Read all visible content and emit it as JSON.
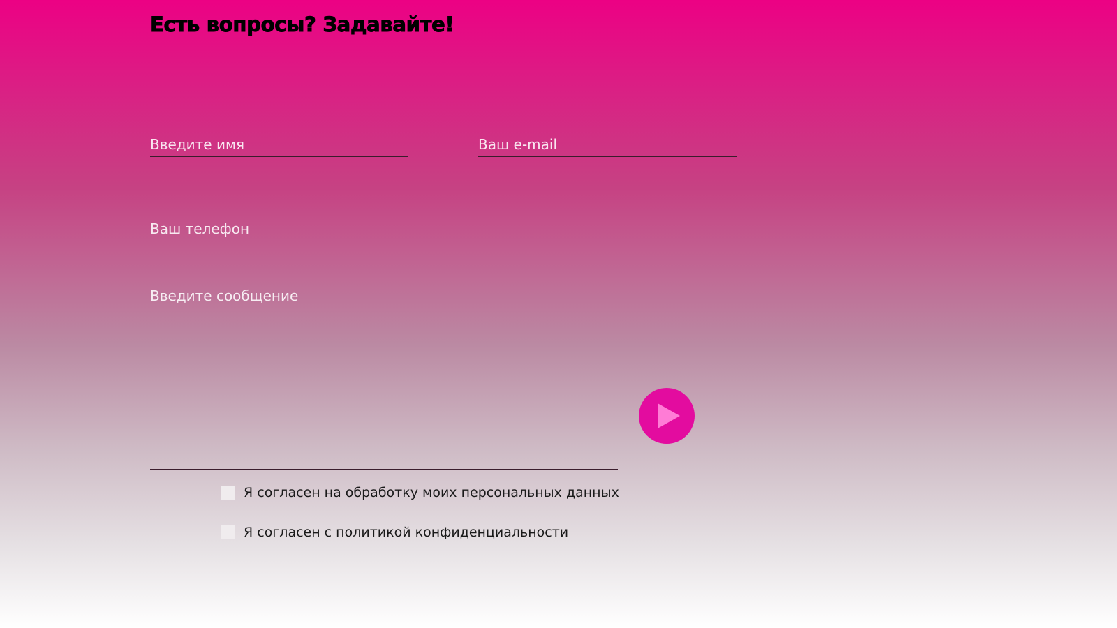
{
  "page": {
    "title": "Есть вопросы? Задавайте!"
  },
  "form": {
    "name_placeholder": "Введите имя",
    "email_placeholder": "Ваш e-mail",
    "phone_placeholder": "Ваш телефон",
    "message_placeholder": "Введите сообщение",
    "send_icon": "play-icon",
    "consents": [
      {
        "label": "Я согласен на обработку моих персональных данных",
        "checked": false
      },
      {
        "label": "Я согласен с политикой конфиденциальности",
        "checked": false
      }
    ]
  },
  "colors": {
    "gradient_top": "#ec0184",
    "gradient_bottom": "#ffffff",
    "accent_button": "#e30c9f",
    "icon_fill": "#ff7cd6",
    "title_text": "#000000",
    "input_text": "#ffffff"
  }
}
